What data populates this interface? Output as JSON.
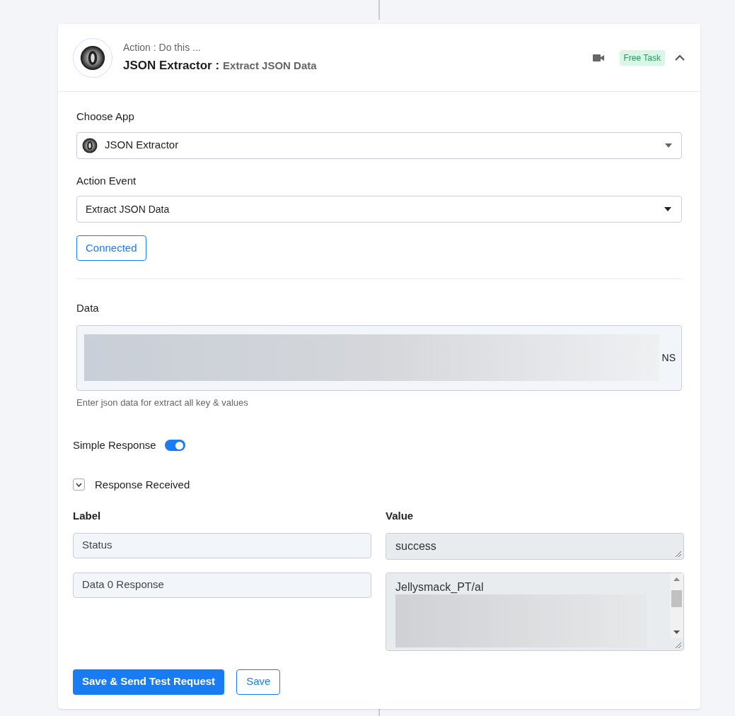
{
  "header": {
    "subtitle": "Action : Do this ...",
    "app_name": "JSON Extractor :",
    "event_name": "Extract JSON Data",
    "badge": "Free Task",
    "expanded": true
  },
  "choose_app": {
    "label": "Choose App",
    "value": "JSON Extractor"
  },
  "action_event": {
    "label": "Action Event",
    "value": "Extract JSON Data"
  },
  "connected_button": "Connected",
  "data_field": {
    "label": "Data",
    "visible_text": "NS",
    "hint": "Enter json data for extract all key & values"
  },
  "simple_response": {
    "label": "Simple Response",
    "on": true
  },
  "response_received": {
    "label": "Response Received",
    "expanded": true
  },
  "columns": [
    "Label",
    "Value"
  ],
  "rows": [
    {
      "label": "Status",
      "value": "success",
      "blurred": false
    },
    {
      "label": "Data 0 Response",
      "value": "Jellysmack_PT/al",
      "blurred": true
    }
  ],
  "buttons": [
    {
      "label": "Save & Send Test Request",
      "kind": "primary"
    },
    {
      "label": "Save",
      "kind": "outline"
    }
  ]
}
